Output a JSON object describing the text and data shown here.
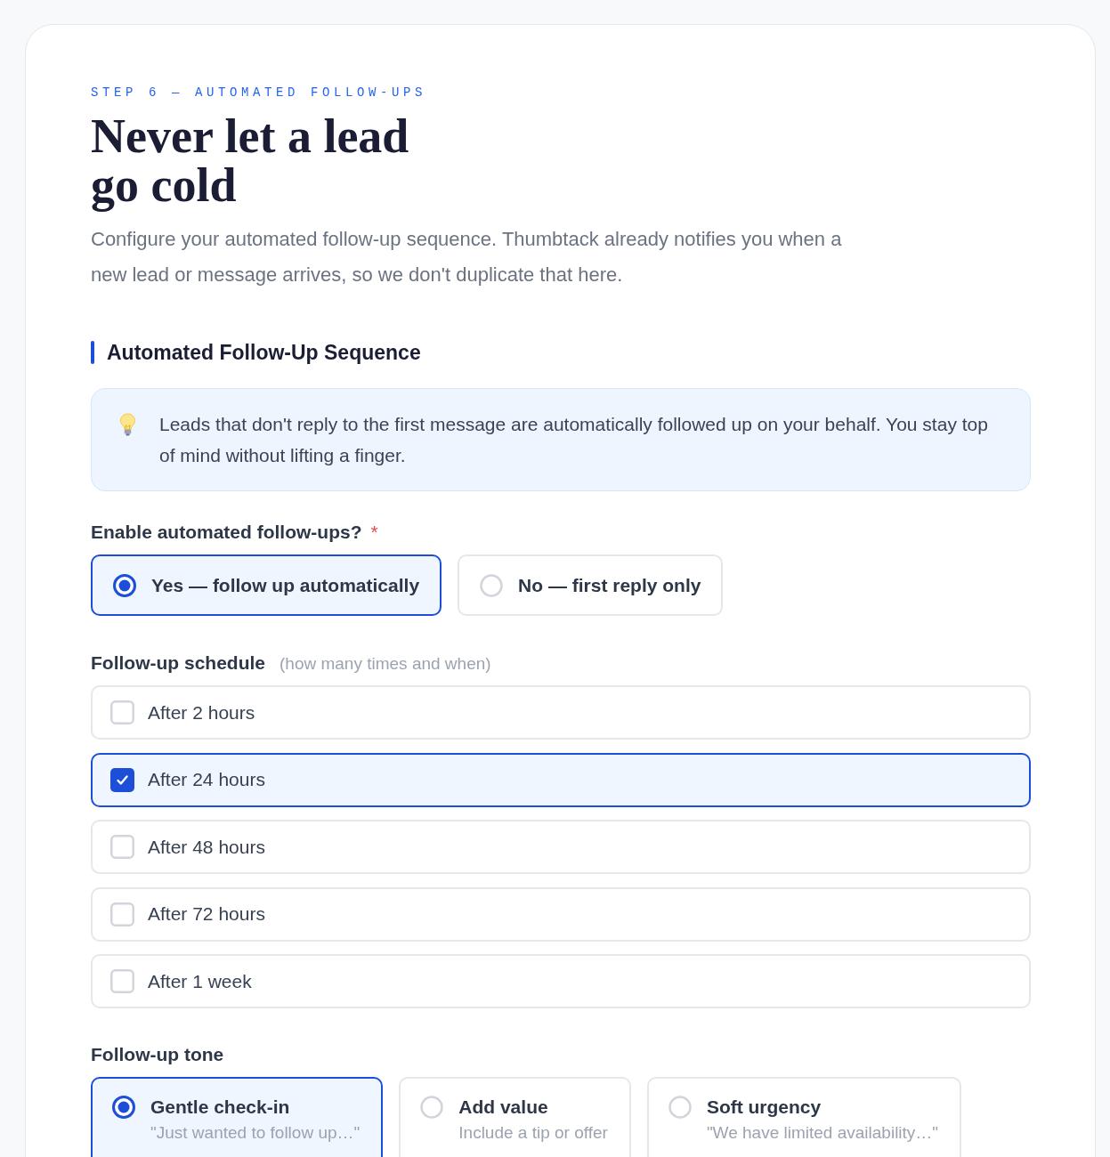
{
  "step_label": "STEP 6 — AUTOMATED FOLLOW-UPS",
  "title": "Never let a lead go cold",
  "subtitle": "Configure your automated follow-up sequence. Thumbtack already notifies you when a new lead or message arrives, so we don't duplicate that here.",
  "section": {
    "title": "Automated Follow-Up Sequence",
    "info": "Leads that don't reply to the first message are automatically followed up on your behalf. You stay top of mind without lifting a finger."
  },
  "enable_question": {
    "label": "Enable automated follow-ups?",
    "required_mark": "*",
    "options": [
      {
        "label": "Yes — follow up automatically",
        "selected": true
      },
      {
        "label": "No — first reply only",
        "selected": false
      }
    ]
  },
  "schedule": {
    "label": "Follow-up schedule",
    "hint": "(how many times and when)",
    "options": [
      {
        "label": "After 2 hours",
        "checked": false
      },
      {
        "label": "After 24 hours",
        "checked": true
      },
      {
        "label": "After 48 hours",
        "checked": false
      },
      {
        "label": "After 72 hours",
        "checked": false
      },
      {
        "label": "After 1 week",
        "checked": false
      }
    ]
  },
  "tone": {
    "label": "Follow-up tone",
    "options": [
      {
        "title": "Gentle check-in",
        "description": "\"Just wanted to follow up…\"",
        "selected": true
      },
      {
        "title": "Add value",
        "description": "Include a tip or offer",
        "selected": false
      },
      {
        "title": "Soft urgency",
        "description": "\"We have limited availability…\"",
        "selected": false
      }
    ]
  }
}
